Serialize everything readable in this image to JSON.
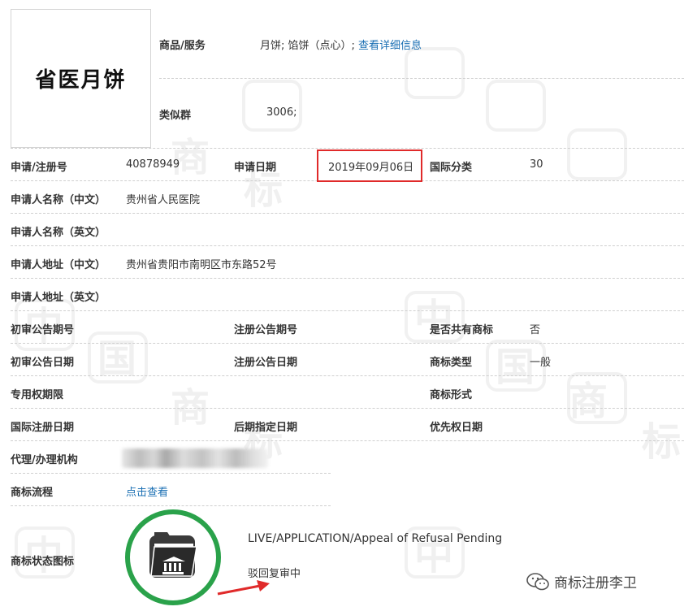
{
  "logo": {
    "text": "省医月饼"
  },
  "goods_services": {
    "label": "商品/服务",
    "value": "月饼; 馅饼（点心）;",
    "link": "查看详细信息"
  },
  "similar_group": {
    "label": "类似群",
    "value": "3006;"
  },
  "row_app": {
    "reg_no_label": "申请/注册号",
    "reg_no": "40878949",
    "date_label": "申请日期",
    "date": "2019年09月06日",
    "class_label": "国际分类",
    "class": "30"
  },
  "applicant_cn": {
    "label": "申请人名称（中文）",
    "value": "贵州省人民医院"
  },
  "applicant_en": {
    "label": "申请人名称（英文）",
    "value": ""
  },
  "address_cn": {
    "label": "申请人地址（中文）",
    "value": "贵州省贵阳市南明区市东路52号"
  },
  "address_en": {
    "label": "申请人地址（英文）",
    "value": ""
  },
  "row_pub_no": {
    "prelim_label": "初审公告期号",
    "reg_label": "注册公告期号",
    "shared_label": "是否共有商标",
    "shared": "否"
  },
  "row_pub_date": {
    "prelim_label": "初审公告日期",
    "reg_label": "注册公告日期",
    "type_label": "商标类型",
    "type": "一般"
  },
  "row_rights": {
    "term_label": "专用权期限",
    "form_label": "商标形式"
  },
  "row_intl": {
    "intl_label": "国际注册日期",
    "later_label": "后期指定日期",
    "priority_label": "优先权日期"
  },
  "agent": {
    "label": "代理/办理机构"
  },
  "process": {
    "label": "商标流程",
    "link": "点击查看"
  },
  "status": {
    "label": "商标状态图标",
    "en": "LIVE/APPLICATION/Appeal of Refusal Pending",
    "cn": "驳回复审中"
  },
  "watermark": {
    "account": "商标注册李卫",
    "chars": [
      "中",
      "国",
      "商",
      "标"
    ]
  },
  "colors": {
    "link": "#1a6fb3",
    "highlight": "#e02a2a",
    "status_ring": "#2aa24a",
    "arrow": "#e02a2a"
  }
}
